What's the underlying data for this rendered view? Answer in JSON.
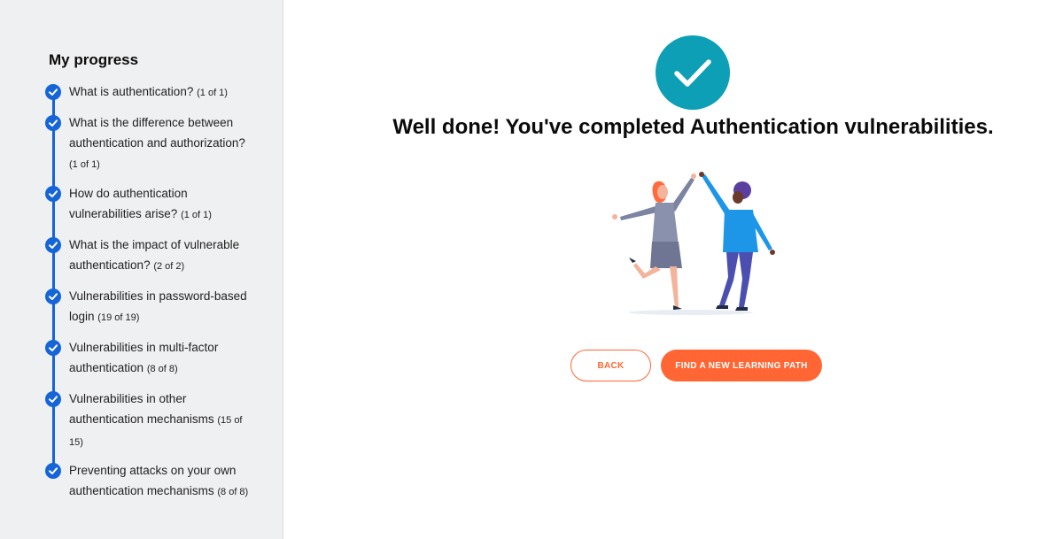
{
  "sidebar": {
    "title": "My progress",
    "items": [
      {
        "label": "What is authentication?",
        "count": "(1 of 1)"
      },
      {
        "label": "What is the difference between authentication and authorization?",
        "count": "(1 of 1)"
      },
      {
        "label": "How do authentication vulnerabilities arise?",
        "count": "(1 of 1)"
      },
      {
        "label": "What is the impact of vulnerable authentication?",
        "count": "(2 of 2)"
      },
      {
        "label": "Vulnerabilities in password-based login",
        "count": "(19 of 19)"
      },
      {
        "label": "Vulnerabilities in multi-factor authentication",
        "count": "(8 of 8)"
      },
      {
        "label": "Vulnerabilities in other authentication mechanisms",
        "count": "(15 of 15)"
      },
      {
        "label": "Preventing attacks on your own authentication mechanisms",
        "count": "(8 of 8)"
      }
    ]
  },
  "main": {
    "headline": "Well done! You've completed Authentication vulnerabilities.",
    "back_label": "BACK",
    "find_label": "FIND A NEW LEARNING PATH",
    "success_icon": "checkmark-icon",
    "illustration": "high-five-illustration"
  },
  "colors": {
    "accent_blue": "#1565d8",
    "teal": "#0d9fb5",
    "orange": "#ff6633",
    "sidebar_bg": "#eff0f2"
  }
}
